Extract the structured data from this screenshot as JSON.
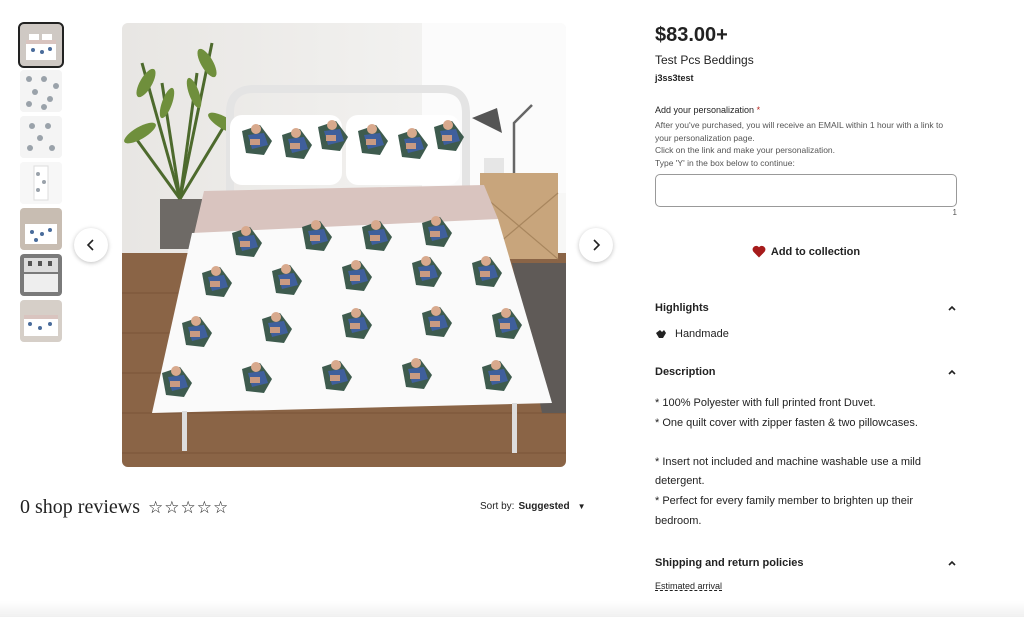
{
  "listing": {
    "price": "$83.00+",
    "title": "Test Pcs Beddings",
    "shop": "j3ss3test"
  },
  "personalization": {
    "label": "Add your personalization",
    "required_mark": "*",
    "instructions": [
      "After you've purchased, you will receive an EMAIL within 1 hour with a link to your personalization page.",
      "Click on the link and make your personalization.",
      "Type 'Y' in the box below to continue:"
    ],
    "input_value": "",
    "char_count": "1"
  },
  "actions": {
    "add_to_collection": "Add to collection"
  },
  "highlights": {
    "heading": "Highlights",
    "items": [
      "Handmade"
    ]
  },
  "description": {
    "heading": "Description",
    "lines": [
      "* 100% Polyester with full printed front Duvet.",
      "* One quilt cover with zipper fasten & two pillowcases.",
      "",
      "* Insert not included and machine washable use a mild detergent.",
      "* Perfect for every family member to brighten up their bedroom."
    ]
  },
  "shipping": {
    "heading": "Shipping and return policies",
    "estimated_arrival": "Estimated arrival"
  },
  "reviews": {
    "title": "0 shop reviews",
    "rating": 0,
    "max_rating": 5,
    "sort_label": "Sort by:",
    "sort_value": "Suggested"
  },
  "gallery": {
    "thumbnail_count": 7,
    "active_index": 0
  },
  "colors": {
    "heart": "#a61b1b",
    "duvet_band": "#d9c4bf",
    "floor": "#8a6446"
  },
  "icons": {
    "prev": "chevron-left-icon",
    "next": "chevron-right-icon",
    "collapse": "chevron-up-icon",
    "heart": "heart-icon",
    "handmade": "hands-icon",
    "sort_caret": "caret-down-icon",
    "star": "star-outline-icon"
  }
}
